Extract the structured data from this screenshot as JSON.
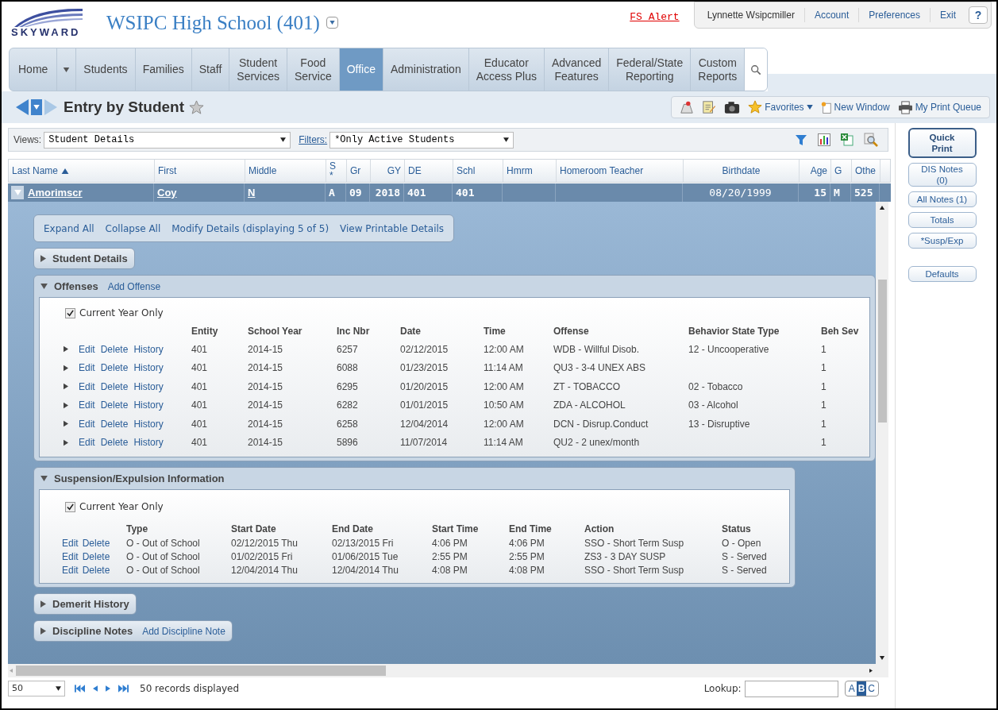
{
  "header": {
    "logo": "SKYWARD",
    "school": "WSIPC High School (401)",
    "alert": "FS Alert",
    "user": "Lynnette Wsipcmiller",
    "links": [
      "Account",
      "Preferences",
      "Exit"
    ],
    "help": "?"
  },
  "nav": [
    {
      "label": "Home",
      "kind": "split",
      "selected": false
    },
    {
      "label": "Students",
      "kind": "tab",
      "selected": false
    },
    {
      "label": "Families",
      "kind": "tab",
      "selected": false
    },
    {
      "label": "Staff",
      "kind": "tab",
      "selected": false
    },
    {
      "label": "Student\nServices",
      "kind": "tab",
      "selected": false
    },
    {
      "label": "Food\nService",
      "kind": "tab",
      "selected": false
    },
    {
      "label": "Office",
      "kind": "tab",
      "selected": true
    },
    {
      "label": "Administration",
      "kind": "tab",
      "selected": false
    },
    {
      "label": "Educator\nAccess Plus",
      "kind": "tab",
      "selected": false
    },
    {
      "label": "Advanced\nFeatures",
      "kind": "tab",
      "selected": false
    },
    {
      "label": "Federal/State\nReporting",
      "kind": "tab",
      "selected": false
    },
    {
      "label": "Custom\nReports",
      "kind": "tab",
      "selected": false
    }
  ],
  "page": {
    "title": "Entry by Student"
  },
  "toolbar": {
    "favorites": "Favorites",
    "new_window": "New Window",
    "print_queue": "My Print Queue"
  },
  "views": {
    "label": "Views:",
    "value": "Student Details"
  },
  "filters": {
    "label": "Filters:",
    "value": "*Only Active Students"
  },
  "table": {
    "columns": [
      {
        "label": "Last Name",
        "sorted": true
      },
      {
        "label": "First",
        "sorted": false
      },
      {
        "label": "Middle",
        "sorted": false
      },
      {
        "label": "S\n*",
        "sorted": false
      },
      {
        "label": "Gr",
        "sorted": false
      },
      {
        "label": "GY",
        "sorted": false
      },
      {
        "label": "DE",
        "sorted": false
      },
      {
        "label": "Schl",
        "sorted": false
      },
      {
        "label": "Hmrm",
        "sorted": false
      },
      {
        "label": "Homeroom Teacher",
        "sorted": false
      },
      {
        "label": "Birthdate",
        "sorted": false
      },
      {
        "label": "Age",
        "sorted": false
      },
      {
        "label": "G",
        "sorted": false
      },
      {
        "label": "Othe",
        "sorted": false
      }
    ],
    "row": {
      "expanded": true,
      "cells": [
        "Amorimscr",
        "Coy",
        "N",
        "A",
        "09",
        "2018",
        "401",
        "401",
        "",
        "",
        "08/20/1999",
        "15",
        "M",
        "525"
      ]
    }
  },
  "detail_links": [
    "Expand All",
    "Collapse All",
    "Modify Details (displaying 5 of 5)",
    "View Printable Details"
  ],
  "sections": [
    {
      "title": "Student Details",
      "expanded": false
    },
    {
      "title": "Offenses",
      "expanded": true,
      "action": "Add Offense",
      "kind": "offenses",
      "current_year": {
        "label": "Current Year Only",
        "checked": true
      },
      "columns": [
        "Entity",
        "School Year",
        "Inc Nbr",
        "Date",
        "Time",
        "Offense",
        "Behavior State Type",
        "Beh Sev"
      ],
      "rows": [
        {
          "actions": [
            "Edit",
            "Delete",
            "History"
          ],
          "cells": [
            "401",
            "2014-15",
            "6257",
            "02/12/2015",
            "12:00 AM",
            "WDB - Willful Disob.",
            "12 - Uncooperative",
            "1"
          ]
        },
        {
          "actions": [
            "Edit",
            "Delete",
            "History"
          ],
          "cells": [
            "401",
            "2014-15",
            "6088",
            "01/23/2015",
            "11:14 AM",
            "QU3 - 3-4 UNEX ABS",
            "",
            "1"
          ]
        },
        {
          "actions": [
            "Edit",
            "Delete",
            "History"
          ],
          "cells": [
            "401",
            "2014-15",
            "6295",
            "01/20/2015",
            "12:00 AM",
            "ZT - TOBACCO",
            "02 - Tobacco",
            "1"
          ]
        },
        {
          "actions": [
            "Edit",
            "Delete",
            "History"
          ],
          "cells": [
            "401",
            "2014-15",
            "6282",
            "01/01/2015",
            "10:50 AM",
            "ZDA - ALCOHOL",
            "03 - Alcohol",
            "1"
          ]
        },
        {
          "actions": [
            "Edit",
            "Delete",
            "History"
          ],
          "cells": [
            "401",
            "2014-15",
            "6258",
            "12/04/2014",
            "12:00 AM",
            "DCN - Disrup.Conduct",
            "13 - Disruptive",
            "1"
          ]
        },
        {
          "actions": [
            "Edit",
            "Delete",
            "History"
          ],
          "cells": [
            "401",
            "2014-15",
            "5896",
            "11/07/2014",
            "11:14 AM",
            "QU2 - 2 unex/month",
            "",
            "1"
          ]
        }
      ]
    },
    {
      "title": "Suspension/Expulsion Information",
      "expanded": true,
      "kind": "suspension",
      "current_year": {
        "label": "Current Year Only",
        "checked": true
      },
      "columns": [
        "Type",
        "Start Date",
        "End Date",
        "Start Time",
        "End Time",
        "Action",
        "Status"
      ],
      "rows": [
        {
          "actions": [
            "Edit",
            "Delete"
          ],
          "cells": [
            "O - Out of School",
            "02/12/2015 Thu",
            "02/13/2015 Fri",
            "4:06 PM",
            "4:06 PM",
            "SSO - Short Term Susp",
            "O - Open"
          ]
        },
        {
          "actions": [
            "Edit",
            "Delete"
          ],
          "cells": [
            "O - Out of School",
            "01/02/2015 Fri",
            "01/06/2015 Tue",
            "2:55 PM",
            "2:55 PM",
            "ZS3 - 3 DAY SUSP",
            "S - Served"
          ]
        },
        {
          "actions": [
            "Edit",
            "Delete"
          ],
          "cells": [
            "O - Out of School",
            "12/04/2014 Thu",
            "12/04/2014 Thu",
            "4:08 PM",
            "4:08 PM",
            "SSO - Short Term Susp",
            "S - Served"
          ]
        }
      ]
    },
    {
      "title": "Demerit History",
      "expanded": false
    },
    {
      "title": "Discipline Notes",
      "expanded": false,
      "action": "Add Discipline Note"
    }
  ],
  "side_buttons": [
    {
      "label": "Quick\nPrint",
      "kind": "primary"
    },
    {
      "label": "DIS Notes\n(0)",
      "kind": "normal"
    },
    {
      "label": "All Notes (1)",
      "kind": "normal"
    },
    {
      "label": "Totals",
      "kind": "normal"
    },
    {
      "label": "*Susp/Exp",
      "kind": "normal"
    },
    {
      "label": "Defaults",
      "kind": "spaced"
    }
  ],
  "footer": {
    "page_size": "50",
    "records": "50 records displayed",
    "lookup_label": "Lookup:",
    "alphabet": [
      {
        "text": "A",
        "selected": false
      },
      {
        "text": "B",
        "selected": true
      },
      {
        "text": "C",
        "selected": false
      }
    ]
  }
}
